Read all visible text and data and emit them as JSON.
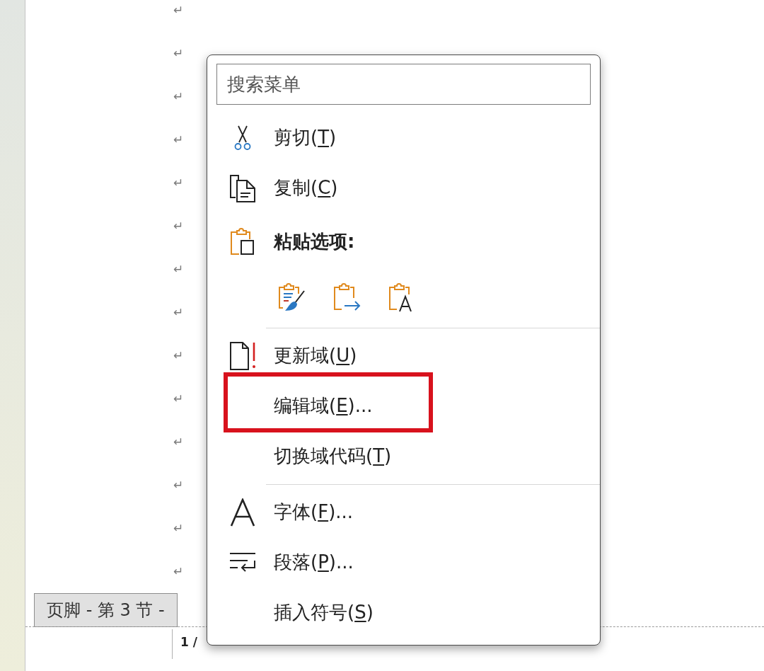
{
  "document": {
    "paragraph_marks": [
      "↵",
      "↵",
      "↵",
      "↵",
      "↵",
      "↵",
      "↵",
      "↵",
      "↵",
      "↵",
      "↵",
      "↵",
      "↵",
      "↵"
    ],
    "footer_label": "页脚 - 第 3 节 -",
    "page_number": "1 /"
  },
  "menu": {
    "search": {
      "placeholder": "搜索菜单"
    },
    "items": [
      {
        "kind": "cut",
        "label": "剪切(",
        "accelerator": "T",
        "label_end": ")",
        "highlighted": false
      },
      {
        "kind": "copy",
        "label": "复制(",
        "accelerator": "C",
        "label_end": ")",
        "highlighted": false
      },
      {
        "kind": "paste_header",
        "label": "粘贴选项:"
      },
      {
        "kind": "paste_options",
        "options": [
          {
            "kind": "keep_source"
          },
          {
            "kind": "merge"
          },
          {
            "kind": "text_only"
          }
        ]
      },
      {
        "kind": "separator"
      },
      {
        "kind": "update_field",
        "label": "更新域(",
        "accelerator": "U",
        "label_end": ")",
        "highlighted": false
      },
      {
        "kind": "command",
        "label": "编辑域(",
        "accelerator": "E",
        "label_end": ")...",
        "highlighted": true
      },
      {
        "kind": "command",
        "label": "切换域代码(",
        "accelerator": "T",
        "label_end": ")",
        "highlighted": false
      },
      {
        "kind": "separator"
      },
      {
        "kind": "font",
        "label": "字体(",
        "accelerator": "F",
        "label_end": ")...",
        "highlighted": false
      },
      {
        "kind": "paragraph",
        "label": "段落(",
        "accelerator": "P",
        "label_end": ")...",
        "highlighted": false
      },
      {
        "kind": "command",
        "label": "插入符号(",
        "accelerator": "S",
        "label_end": ")",
        "highlighted": false
      }
    ]
  }
}
